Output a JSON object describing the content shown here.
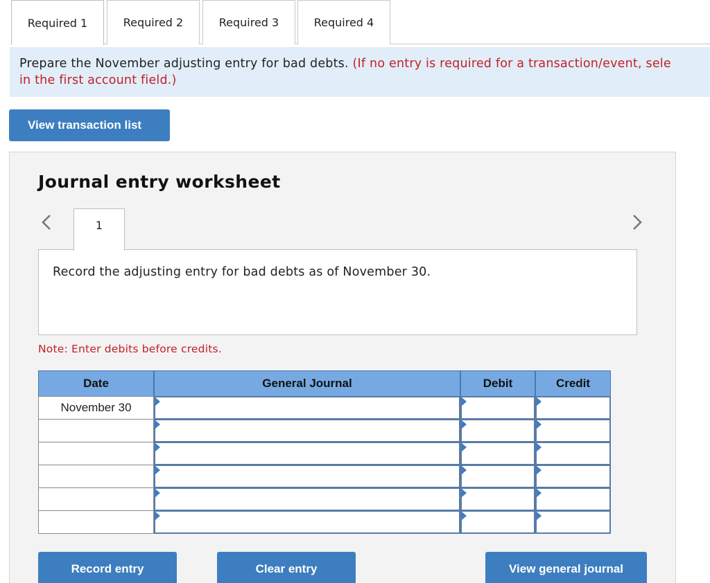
{
  "tabs": [
    {
      "label": "Required 1",
      "active": true
    },
    {
      "label": "Required 2",
      "active": false
    },
    {
      "label": "Required 3",
      "active": false
    },
    {
      "label": "Required 4",
      "active": false
    }
  ],
  "banner": {
    "text": "Prepare the November adjusting entry for bad debts. ",
    "hint": "(If no entry is required for a transaction/event, sele",
    "hint_line2": "in the first account field.)"
  },
  "buttons": {
    "view_transaction_list": "View transaction list",
    "record_entry": "Record entry",
    "clear_entry": "Clear entry",
    "view_general_journal": "View general journal"
  },
  "worksheet": {
    "title": "Journal entry worksheet",
    "entry_tab": "1",
    "prev_icon": "chevron-left-icon",
    "next_icon": "chevron-right-icon",
    "instruction": "Record the adjusting entry for bad debts as of November 30.",
    "note": "Note: Enter debits before credits."
  },
  "journal": {
    "headers": {
      "date": "Date",
      "general_journal": "General Journal",
      "debit": "Debit",
      "credit": "Credit"
    },
    "rows": [
      {
        "date": "November 30",
        "account": "",
        "debit": "",
        "credit": ""
      },
      {
        "date": "",
        "account": "",
        "debit": "",
        "credit": ""
      },
      {
        "date": "",
        "account": "",
        "debit": "",
        "credit": ""
      },
      {
        "date": "",
        "account": "",
        "debit": "",
        "credit": ""
      },
      {
        "date": "",
        "account": "",
        "debit": "",
        "credit": ""
      },
      {
        "date": "",
        "account": "",
        "debit": "",
        "credit": ""
      }
    ]
  },
  "colors": {
    "accent_button": "#3d7ec0",
    "header_blue": "#76a9e2",
    "banner_bg": "#e1eef9",
    "hint_red": "#c32026"
  }
}
